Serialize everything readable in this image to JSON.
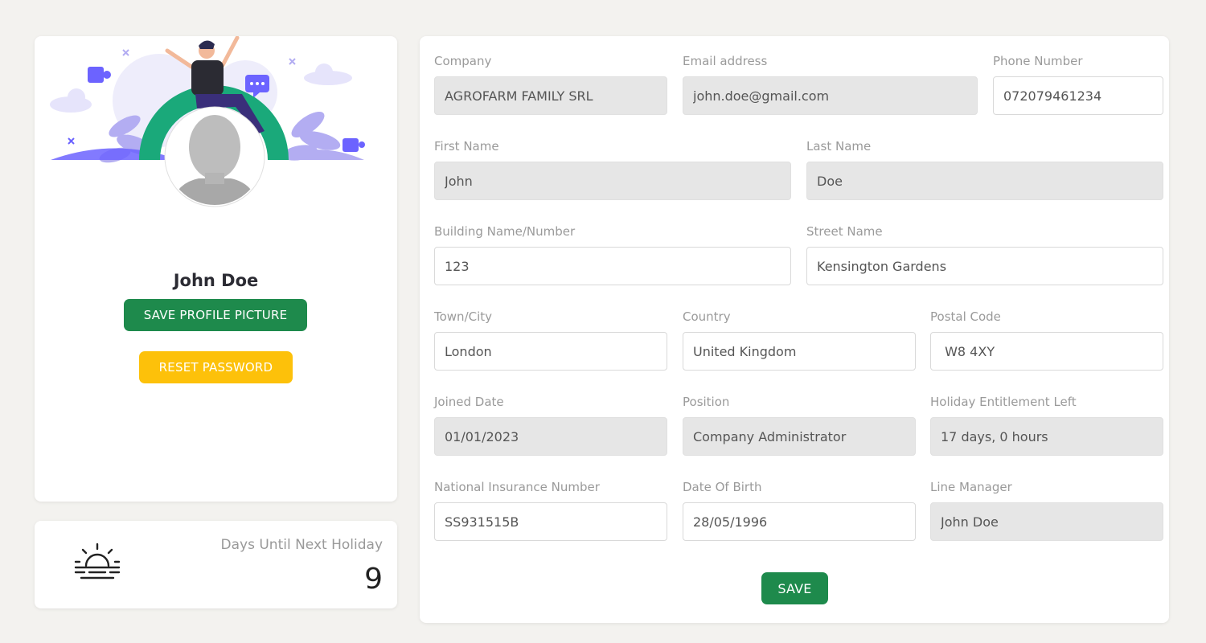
{
  "profile": {
    "name": "John Doe",
    "save_picture_label": "SAVE PROFILE PICTURE",
    "reset_password_label": "RESET PASSWORD"
  },
  "holiday": {
    "label": "Days Until Next Holiday",
    "value": "9"
  },
  "form": {
    "company": {
      "label": "Company",
      "value": "AGROFARM FAMILY SRL"
    },
    "email": {
      "label": "Email address",
      "value": "john.doe@gmail.com"
    },
    "phone": {
      "label": "Phone Number",
      "value": "072079461234"
    },
    "first_name": {
      "label": "First Name",
      "value": "John"
    },
    "last_name": {
      "label": "Last Name",
      "value": "Doe"
    },
    "building": {
      "label": "Building Name/Number",
      "value": "123"
    },
    "street": {
      "label": "Street Name",
      "value": "Kensington Gardens"
    },
    "town": {
      "label": "Town/City",
      "value": "London"
    },
    "country": {
      "label": "Country",
      "value": "United Kingdom"
    },
    "postal_code": {
      "label": "Postal Code",
      "value": " W8 4XY"
    },
    "joined_date": {
      "label": "Joined Date",
      "value": "01/01/2023"
    },
    "position": {
      "label": "Position",
      "value": "Company Administrator"
    },
    "holiday_left": {
      "label": "Holiday Entitlement Left",
      "value": "17 days, 0 hours"
    },
    "ni_number": {
      "label": "National Insurance Number",
      "value": "SS931515B"
    },
    "dob": {
      "label": "Date Of Birth",
      "value": "28/05/1996"
    },
    "line_manager": {
      "label": "Line Manager",
      "value": "John Doe"
    },
    "save_label": "SAVE"
  },
  "colors": {
    "primary_green": "#1e8a4c",
    "warning_yellow": "#fdc10a",
    "illustration_purple": "#6c63ff",
    "illustration_teal": "#1aa97a"
  },
  "icons": {
    "holiday": "sunrise-icon",
    "avatar": "user-avatar-placeholder"
  }
}
